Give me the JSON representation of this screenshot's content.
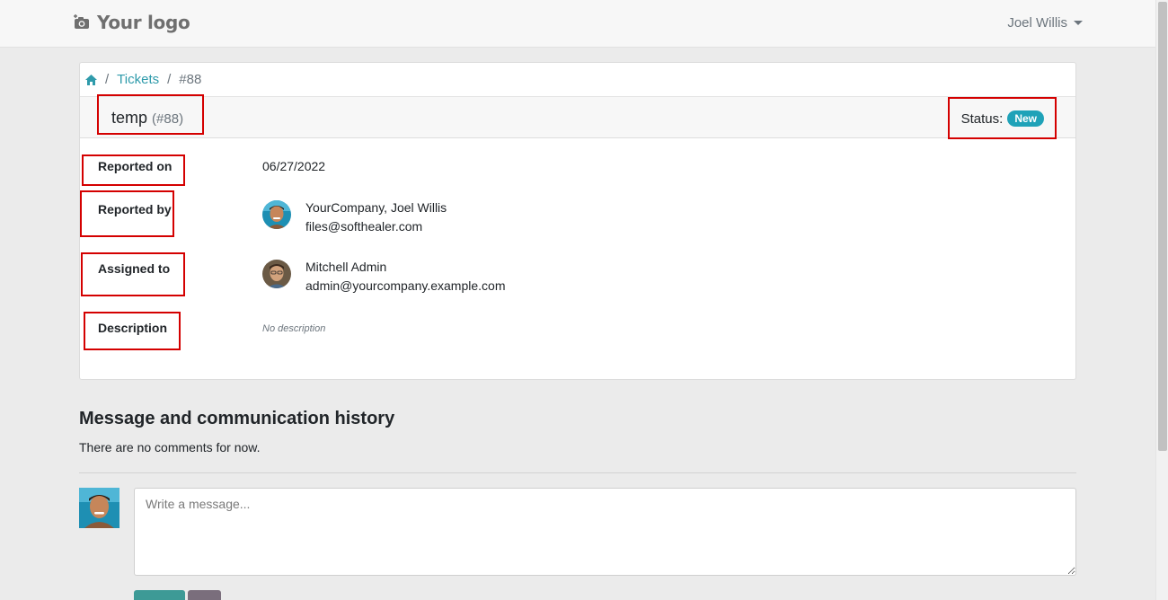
{
  "navbar": {
    "logo_icon": "camera-icon",
    "logo_text": "Your logo",
    "user_name": "Joel Willis"
  },
  "breadcrumb": {
    "home_icon": "home-icon",
    "separator": "/",
    "tickets": "Tickets",
    "current": "#88"
  },
  "ticket": {
    "name": "temp",
    "number": "(#88)",
    "status_label": "Status:",
    "status_value": "New"
  },
  "details": {
    "reported_on_label": "Reported on",
    "reported_on_value": "06/27/2022",
    "reported_by_label": "Reported by",
    "reported_by_name": "YourCompany, Joel Willis",
    "reported_by_email": "files@softhealer.com",
    "assigned_to_label": "Assigned to",
    "assigned_to_name": "Mitchell Admin",
    "assigned_to_email": "admin@yourcompany.example.com",
    "description_label": "Description",
    "description_value": "No description"
  },
  "history": {
    "title": "Message and communication history",
    "empty_text": "There are no comments for now.",
    "message_placeholder": "Write a message..."
  },
  "colors": {
    "accent": "#2f9bab",
    "badge": "#1fa2b8",
    "highlight": "#d40000",
    "send_button": "#3d9a96",
    "attach_button": "#7a6e7c"
  }
}
